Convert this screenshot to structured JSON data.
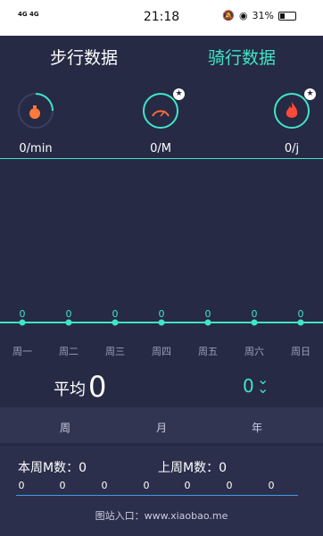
{
  "status_bar": {
    "signal": "4G 4G",
    "time": "21:18",
    "battery": "31%",
    "battery_fraction": 0.31
  },
  "tabs": {
    "walk": "步行数据",
    "ride": "骑行数据"
  },
  "stats": [
    {
      "value": "0/min",
      "icon": "stopwatch-icon"
    },
    {
      "value": "0/M",
      "icon": "speedometer-icon"
    },
    {
      "value": "0/j",
      "icon": "flame-icon"
    }
  ],
  "chart_data": {
    "type": "line",
    "categories": [
      "周一",
      "周二",
      "周三",
      "周四",
      "周五",
      "周六",
      "周日"
    ],
    "values": [
      0,
      0,
      0,
      0,
      0,
      0,
      0
    ],
    "title": "",
    "xlabel": "",
    "ylabel": "",
    "ylim": [
      0,
      1
    ],
    "grid": false
  },
  "average": {
    "label": "平均",
    "value": "0",
    "right_value": "0"
  },
  "periods": [
    "周",
    "月",
    "年"
  ],
  "summary": {
    "current_week": "本周M数：0",
    "last_week": "上周M数：0",
    "daily": [
      "0",
      "0",
      "0",
      "0",
      "0",
      "0",
      "0"
    ]
  },
  "watermark": "图站入口：www.xiaobao.me",
  "colors": {
    "accent": "#3fe5c7",
    "background": "#262a44"
  }
}
